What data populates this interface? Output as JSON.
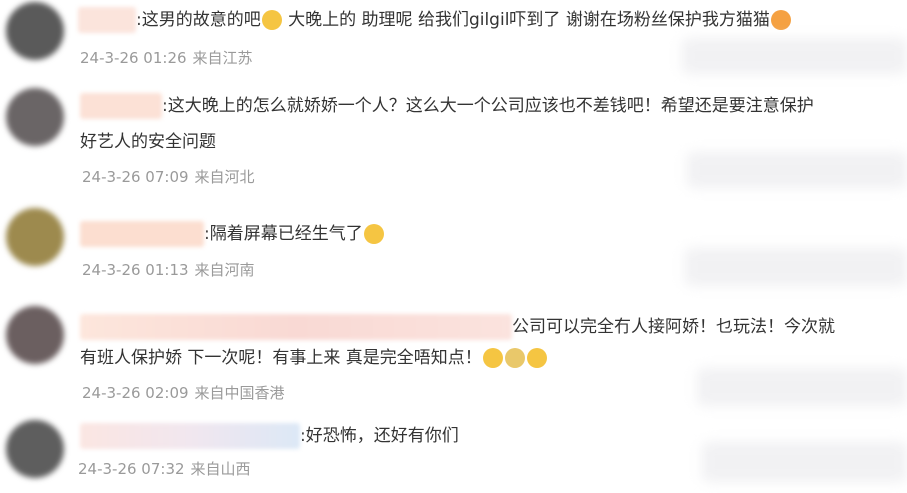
{
  "comments": [
    {
      "text_a": ":这男的故意的吧",
      "emoji_a": "😭",
      "text_b": " 大晚上的 助理呢 给我们gilgil吓到了 谢谢在场粉丝保护我方猫猫",
      "emoji_b": "😍",
      "time": "24-3-26 01:26",
      "location": "来自江苏"
    },
    {
      "line1": ":这大晚上的怎么就娇娇一个人？这么大一个公司应该也不差钱吧！希望还是要注意保护",
      "line2": "好艺人的安全问题",
      "time": "24-3-26 07:09",
      "location": "来自河北"
    },
    {
      "text_a": ":隔着屏幕已经生气了",
      "emoji_a": "🙂",
      "time": "24-3-26 01:13",
      "location": "来自河南"
    },
    {
      "line1": "公司可以完全冇人接阿娇！乜玩法！今次就",
      "line2": "有班人保护娇 下一次呢！有事上来 真是完全唔知点！",
      "emoji_a": "😭",
      "emoji_b": "😢",
      "emoji_c": "😅",
      "time": "24-3-26 02:09",
      "location": "来自中国香港"
    },
    {
      "text_a": ":好恐怖，还好有你们",
      "time": "24-3-26 07:32",
      "location": "来自山西"
    }
  ],
  "colors": {
    "text": "#333333",
    "meta": "#9a9a9a",
    "emoji_face": "#f5c542"
  }
}
